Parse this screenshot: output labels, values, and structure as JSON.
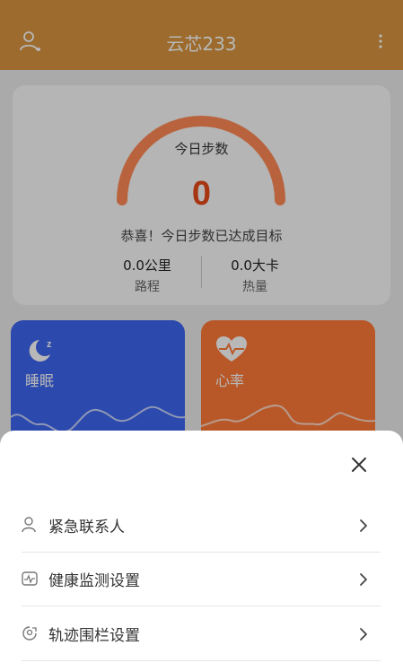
{
  "app": {
    "title": "云芯233"
  },
  "steps": {
    "label": "今日步数",
    "value": "0",
    "congrats": "恭喜！今日步数已达成目标",
    "distance_value": "0.0公里",
    "distance_label": "路程",
    "calorie_value": "0.0大卡",
    "calorie_label": "热量"
  },
  "tiles": {
    "sleep_label": "睡眠",
    "heart_label": "心率"
  },
  "sheet": {
    "items": [
      {
        "label": "紧急联系人",
        "icon": "person-icon"
      },
      {
        "label": "健康监测设置",
        "icon": "health-monitor-icon"
      },
      {
        "label": "轨迹围栏设置",
        "icon": "fence-icon"
      }
    ]
  },
  "colors": {
    "header": "#d8953f",
    "steps_value": "#e84a1a",
    "sleep_tile": "#3e66f0",
    "heart_tile": "#ff7b3a"
  }
}
